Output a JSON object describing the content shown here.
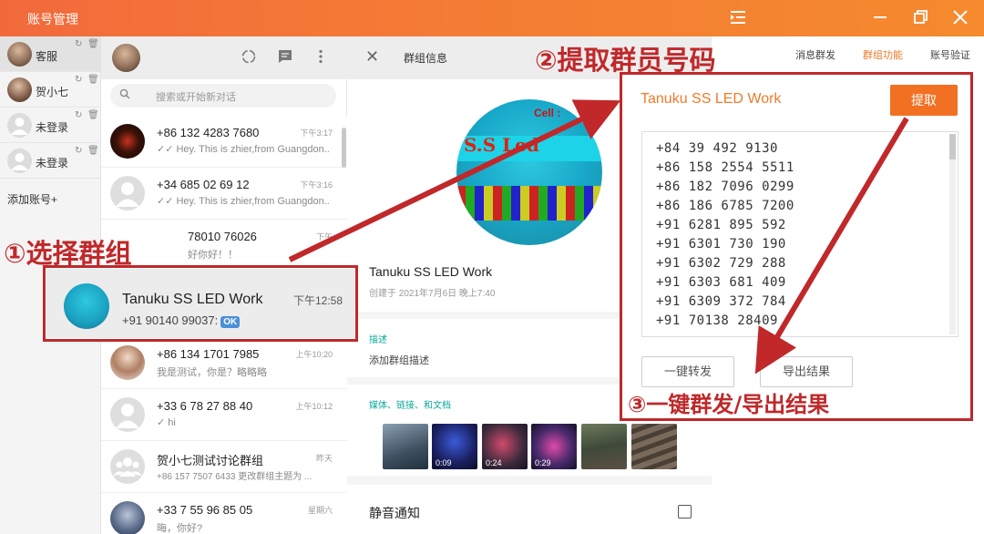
{
  "window": {
    "title": "账号管理",
    "colors": {
      "titlebar": "#f47a35",
      "accent": "#f07a2a",
      "annotation": "#c0282a",
      "teal_label": "#0aa89b"
    }
  },
  "accounts": {
    "items": [
      {
        "name": "客服",
        "active": true
      },
      {
        "name": "贺小七",
        "active": false
      },
      {
        "name": "未登录",
        "active": false
      },
      {
        "name": "未登录",
        "active": false
      }
    ],
    "add_label": "添加账号+"
  },
  "chatlist": {
    "search_placeholder": "搜索或开始新对话",
    "chats": [
      {
        "name": "+86 132 4283 7680",
        "message": "✓✓ Hey. This is zhier,from Guangdon...",
        "time": "下午3:17"
      },
      {
        "name": "+34 685 02 69 12",
        "message": "✓✓ Hey. This is zhier,from Guangdon...",
        "time": "下午3:16"
      },
      {
        "name": "78010 76026",
        "message": "好你好！！",
        "time": "下午"
      },
      {
        "name": "+86 134 1701 7985",
        "message": "我是测试，你是？略略略",
        "time": "上午10:20"
      },
      {
        "name": "+33 6 78 27 88 40",
        "message": "✓ hi",
        "time": "上午10:12"
      },
      {
        "name": "贺小七测试讨论群组",
        "message": "+86 157 7507 6433 更改群组主题为 ...",
        "time": "昨天"
      },
      {
        "name": "+33 7 55 96 85 05",
        "message": "晦，你好?",
        "time": "星期六"
      }
    ],
    "selected": {
      "name": "Tanuku SS LED Work",
      "message": "+91 90140 99037:",
      "badge": "OK",
      "time": "下午12:58"
    }
  },
  "group_info": {
    "header_title": "群组信息",
    "logo_text": "S.S Led",
    "logo_cell": "Cell :",
    "name": "Tanuku SS LED Work",
    "created": "创建于 2021年7月6日 晚上7:40",
    "description_label": "描述",
    "description_value": "添加群组描述",
    "media_label": "媒体、链接、和文档",
    "media": [
      {
        "type": "image",
        "label": ""
      },
      {
        "type": "video",
        "label": "0:09"
      },
      {
        "type": "video",
        "label": "0:24"
      },
      {
        "type": "video",
        "label": "0:29"
      },
      {
        "type": "image",
        "label": ""
      },
      {
        "type": "image",
        "label": ""
      }
    ],
    "mute_label": "静音通知"
  },
  "right_panel": {
    "tabs": [
      {
        "label": "消息群发",
        "active": false
      },
      {
        "label": "群组功能",
        "active": true
      },
      {
        "label": "账号验证",
        "active": false
      }
    ],
    "group_name": "Tanuku SS LED Work",
    "extract_label": "提取",
    "numbers": [
      "+84 39 492 9130",
      "+86 158 2554 5511",
      "+86 182 7096 0299",
      "+86 186 6785 7200",
      "+91 6281 895 592",
      "+91 6301 730 190",
      "+91 6302 729 288",
      "+91 6303 681 409",
      "+91 6309 372 784",
      "+91 70138 28409"
    ],
    "forward_label": "一键转发",
    "export_label": "导出结果"
  },
  "annotations": {
    "step1": "①选择群组",
    "step2": "②提取群员号码",
    "step3": "③一键群发/导出结果"
  }
}
